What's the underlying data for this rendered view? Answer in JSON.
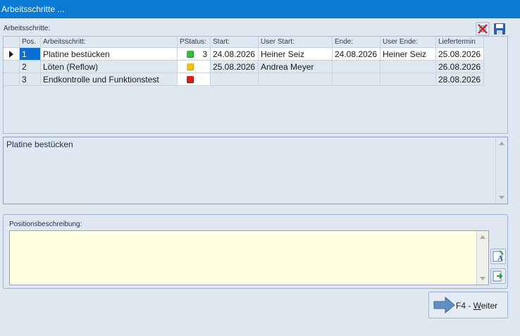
{
  "window": {
    "title": "Arbeitsschritte ..."
  },
  "section": {
    "label": "Arbeitsschritte:"
  },
  "toolbar": {
    "close_icon": "close-cross-icon",
    "save_icon": "floppy-disk-icon"
  },
  "grid": {
    "headers": {
      "pos": "Pos.",
      "step": "Arbeitsschritt:",
      "status": "PStatus:",
      "start": "Start:",
      "user_start": "User Start:",
      "end": "Ende:",
      "user_end": "User Ende:",
      "delivery": "Liefertermin"
    },
    "rows": [
      {
        "pos": "1",
        "step": "Platine bestücken",
        "status_color": "#2fbf3a",
        "status_num": "3",
        "start": "24.08.2026",
        "user_start": "Heiner Seiz",
        "end": "24.08.2026",
        "user_end": "Heiner Seiz",
        "delivery": "25.08.2026"
      },
      {
        "pos": "2",
        "step": "Löten (Reflow)",
        "status_color": "#f2c21a",
        "status_num": "",
        "start": "25.08.2026",
        "user_start": "Andrea Meyer",
        "end": "",
        "user_end": "",
        "delivery": "26.08.2026"
      },
      {
        "pos": "3",
        "step": "Endkontrolle und Funktionstest",
        "status_color": "#d92020",
        "status_num": "",
        "start": "",
        "user_start": "",
        "end": "",
        "user_end": "",
        "delivery": "28.08.2026"
      }
    ]
  },
  "description": {
    "text": "Platine bestücken"
  },
  "position": {
    "label": "Positionsbeschreibung:",
    "value": ""
  },
  "footer": {
    "weiter_prefix": "F4 - ",
    "weiter_underlined": "W",
    "weiter_rest": "eiter"
  }
}
